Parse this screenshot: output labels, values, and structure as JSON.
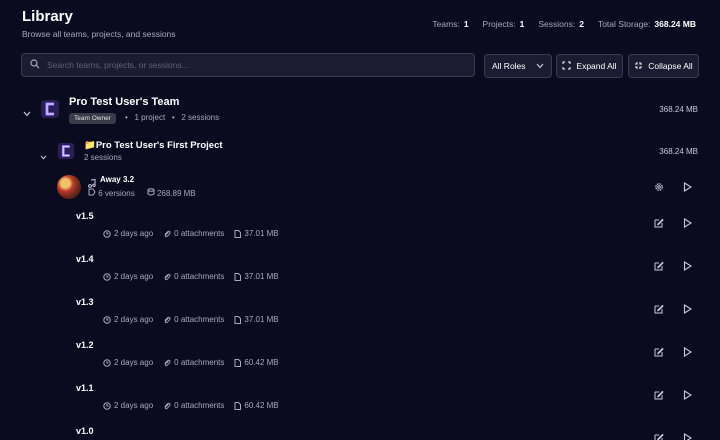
{
  "header": {
    "title": "Library",
    "subtitle": "Browse all teams, projects, and sessions",
    "stats": {
      "teams_label": "Teams:",
      "teams_value": "1",
      "projects_label": "Projects:",
      "projects_value": "1",
      "sessions_label": "Sessions:",
      "sessions_value": "2",
      "storage_label": "Total Storage:",
      "storage_value": "368.24 MB"
    }
  },
  "toolbar": {
    "search_placeholder": "Search teams, projects, or sessions...",
    "roles_label": "All Roles",
    "expand_label": "Expand All",
    "collapse_label": "Collapse All"
  },
  "team": {
    "name": "Pro Test User's Team",
    "badge": "Team Owner",
    "projects": "1 project",
    "sessions": "2 sessions",
    "size": "368.24 MB",
    "dot": "•"
  },
  "project": {
    "name": "📁Pro Test User's First Project",
    "sessions": "2 sessions",
    "size": "368.24 MB"
  },
  "session": {
    "name": "Away 3.2",
    "versions": "6 versions",
    "size": "268.89 MB"
  },
  "versions": [
    {
      "name": "v1.5",
      "age": "2 days ago",
      "attachments": "0 attachments",
      "size": "37.01 MB"
    },
    {
      "name": "v1.4",
      "age": "2 days ago",
      "attachments": "0 attachments",
      "size": "37.01 MB"
    },
    {
      "name": "v1.3",
      "age": "2 days ago",
      "attachments": "0 attachments",
      "size": "37.01 MB"
    },
    {
      "name": "v1.2",
      "age": "2 days ago",
      "attachments": "0 attachments",
      "size": "60.42 MB"
    },
    {
      "name": "v1.1",
      "age": "2 days ago",
      "attachments": "0 attachments",
      "size": "60.42 MB"
    },
    {
      "name": "v1.0",
      "age": "",
      "attachments": "",
      "size": ""
    }
  ]
}
